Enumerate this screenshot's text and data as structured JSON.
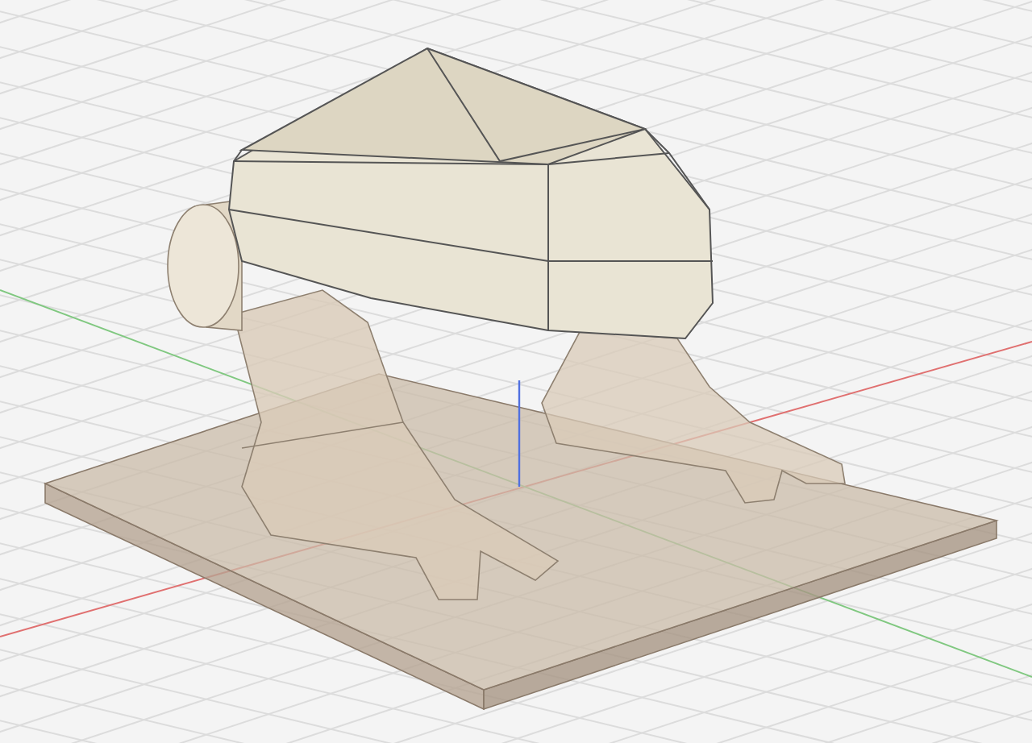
{
  "viewport": {
    "kind": "cad-3d"
  }
}
